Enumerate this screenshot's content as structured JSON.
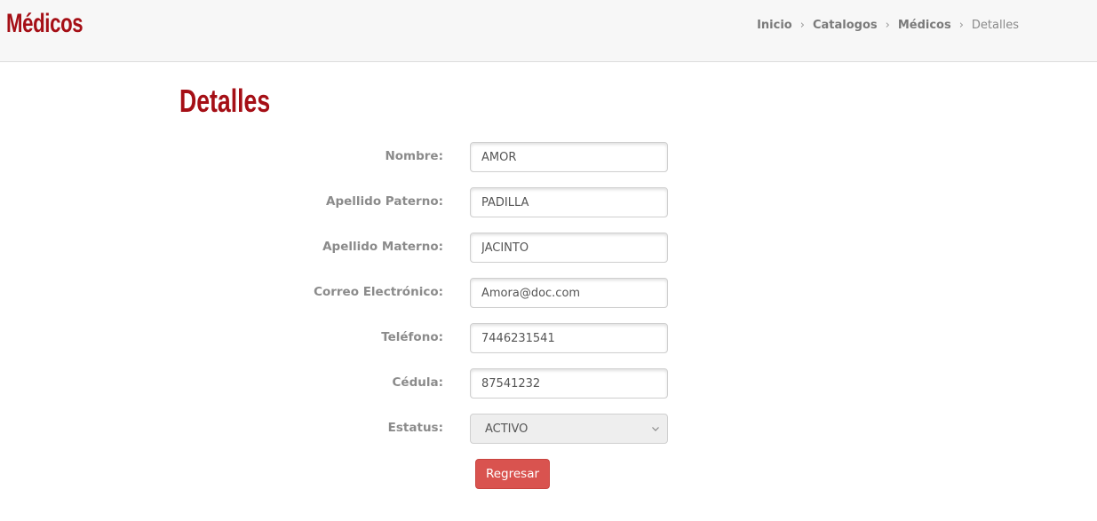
{
  "header": {
    "title": "Médicos",
    "breadcrumb": [
      "Inicio",
      "Catalogos",
      "Médicos"
    ],
    "breadcrumb_current": "Detalles",
    "separator": "›"
  },
  "page": {
    "title": "Detalles"
  },
  "form": {
    "fields": [
      {
        "label": "Nombre:",
        "value": "AMOR"
      },
      {
        "label": "Apellido Paterno:",
        "value": "PADILLA"
      },
      {
        "label": "Apellido Materno:",
        "value": "JACINTO"
      },
      {
        "label": "Correo Electrónico:",
        "value": "Amora@doc.com"
      },
      {
        "label": "Teléfono:",
        "value": "7446231541"
      },
      {
        "label": "Cédula:",
        "value": "87541232"
      }
    ],
    "status": {
      "label": "Estatus:",
      "value": "ACTIVO"
    },
    "back_button": "Regresar"
  },
  "colors": {
    "brand": "#a50f16",
    "button": "#d9534f"
  }
}
